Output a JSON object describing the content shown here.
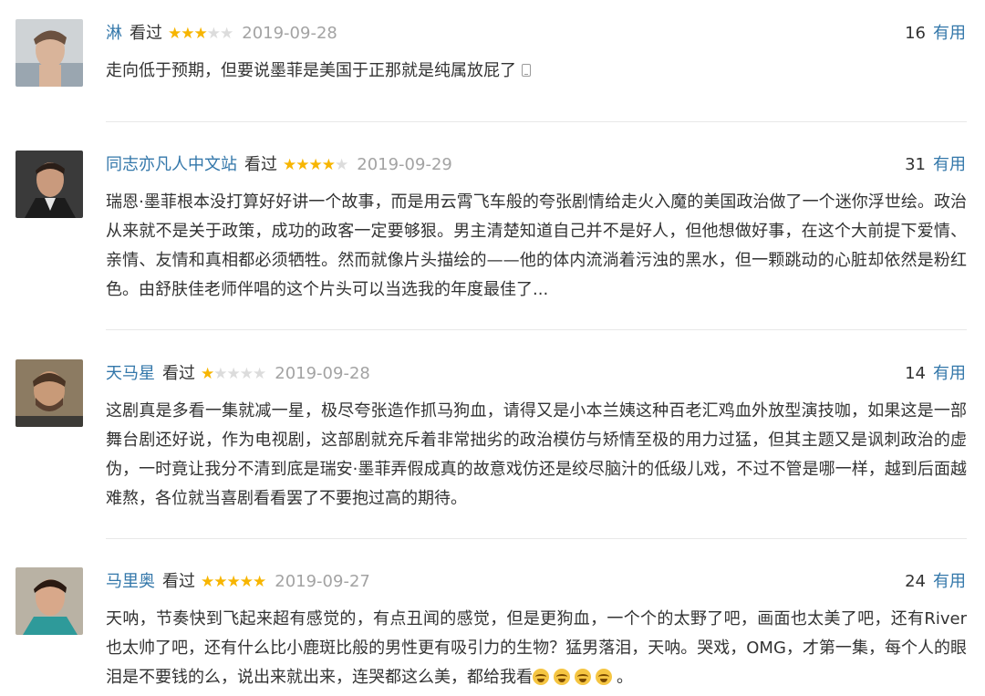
{
  "reviews": [
    {
      "user": "淋",
      "status": "看过",
      "rating": 3,
      "date": "2019-09-28",
      "votes": "16",
      "useful_label": "有用",
      "text": "走向低于预期，但要说墨菲是美国于正那就是纯属放屁了"
    },
    {
      "user": "同志亦凡人中文站",
      "status": "看过",
      "rating": 4,
      "date": "2019-09-29",
      "votes": "31",
      "useful_label": "有用",
      "text": "瑞恩·墨菲根本没打算好好讲一个故事，而是用云霄飞车般的夸张剧情给走火入魔的美国政治做了一个迷你浮世绘。政治从来就不是关于政策，成功的政客一定要够狠。男主清楚知道自己并不是好人，但他想做好事，在这个大前提下爱情、亲情、友情和真相都必须牺牲。然而就像片头描绘的——他的体内流淌着污浊的黑水，但一颗跳动的心脏却依然是粉红色。由舒肤佳老师伴唱的这个片头可以当选我的年度最佳了..."
    },
    {
      "user": "天马星",
      "status": "看过",
      "rating": 1,
      "date": "2019-09-28",
      "votes": "14",
      "useful_label": "有用",
      "text": "这剧真是多看一集就减一星，极尽夸张造作抓马狗血，请得又是小本兰姨这种百老汇鸡血外放型演技咖，如果这是一部舞台剧还好说，作为电视剧，这部剧就充斥着非常拙劣的政治模仿与矫情至极的用力过猛，但其主题又是讽刺政治的虚伪，一时竟让我分不清到底是瑞安·墨菲弄假成真的故意戏仿还是绞尽脑汁的低级儿戏，不过不管是哪一样，越到后面越难熬，各位就当喜剧看看罢了不要抱过高的期待。"
    },
    {
      "user": "马里奥",
      "status": "看过",
      "rating": 5,
      "date": "2019-09-27",
      "votes": "24",
      "useful_label": "有用",
      "text": "天呐，节奏快到飞起来超有感觉的，有点丑闻的感觉，但是更狗血，一个个的太野了吧，画面也太美了吧，还有River也太帅了吧，还有什么比小鹿斑比般的男性更有吸引力的生物？猛男落泪，天呐。哭戏，OMG，才第一集，每个人的眼泪是不要钱的么，说出来就出来，连哭都这么美，都给我看",
      "text_tail": "。"
    }
  ],
  "colors": {
    "link": "#3377aa",
    "star_on": "#f7b500",
    "star_off": "#dcdcdc",
    "date": "#a3a3a3",
    "text": "#333333"
  },
  "icons": {
    "mobile": "mobile-phone-icon",
    "emoji": "crying-face-icon"
  }
}
